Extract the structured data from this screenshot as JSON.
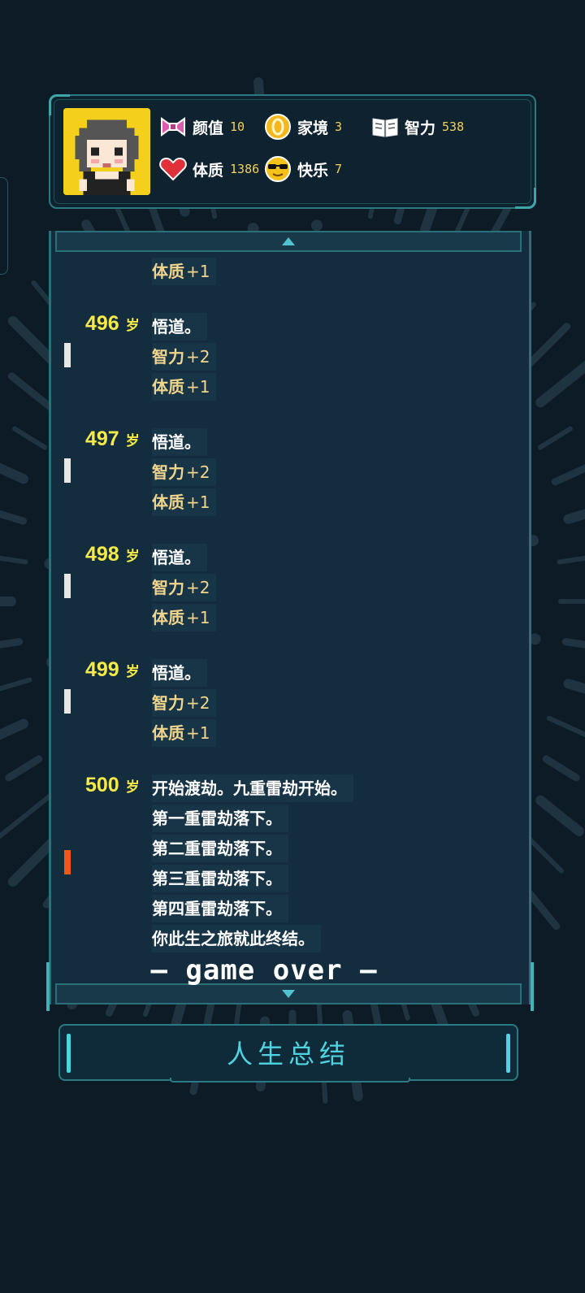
{
  "stats": [
    {
      "key": "appearance",
      "label": "颜值",
      "value": "10",
      "icon": "bow-icon"
    },
    {
      "key": "family",
      "label": "家境",
      "value": "3",
      "icon": "coin-icon"
    },
    {
      "key": "intelligence",
      "label": "智力",
      "value": "538",
      "icon": "book-icon"
    },
    {
      "key": "constitution",
      "label": "体质",
      "value": "1386",
      "icon": "heart-icon"
    },
    {
      "key": "happiness",
      "label": "快乐",
      "value": "7",
      "icon": "sunglasses-face-icon"
    }
  ],
  "log": {
    "top_partial": {
      "text": "体质",
      "delta": "+1"
    },
    "entries": [
      {
        "age": "496",
        "unit": "岁",
        "event": "悟道。",
        "gains": [
          {
            "text": "智力",
            "delta": "+2"
          },
          {
            "text": "体质",
            "delta": "+1"
          }
        ]
      },
      {
        "age": "497",
        "unit": "岁",
        "event": "悟道。",
        "gains": [
          {
            "text": "智力",
            "delta": "+2"
          },
          {
            "text": "体质",
            "delta": "+1"
          }
        ]
      },
      {
        "age": "498",
        "unit": "岁",
        "event": "悟道。",
        "gains": [
          {
            "text": "智力",
            "delta": "+2"
          },
          {
            "text": "体质",
            "delta": "+1"
          }
        ]
      },
      {
        "age": "499",
        "unit": "岁",
        "event": "悟道。",
        "gains": [
          {
            "text": "智力",
            "delta": "+2"
          },
          {
            "text": "体质",
            "delta": "+1"
          }
        ]
      }
    ],
    "final": {
      "age": "500",
      "unit": "岁",
      "lines": [
        "开始渡劫。九重雷劫开始。",
        "第一重雷劫落下。",
        "第二重雷劫落下。",
        "第三重雷劫落下。",
        "第四重雷劫落下。",
        "你此生之旅就此终结。"
      ]
    },
    "game_over": "— game over —"
  },
  "summary_button": "人生总结",
  "colors": {
    "accent": "#4fd3e0",
    "age": "#f6e94a",
    "gain": "#f1d58c",
    "panel": "#132d3f"
  }
}
